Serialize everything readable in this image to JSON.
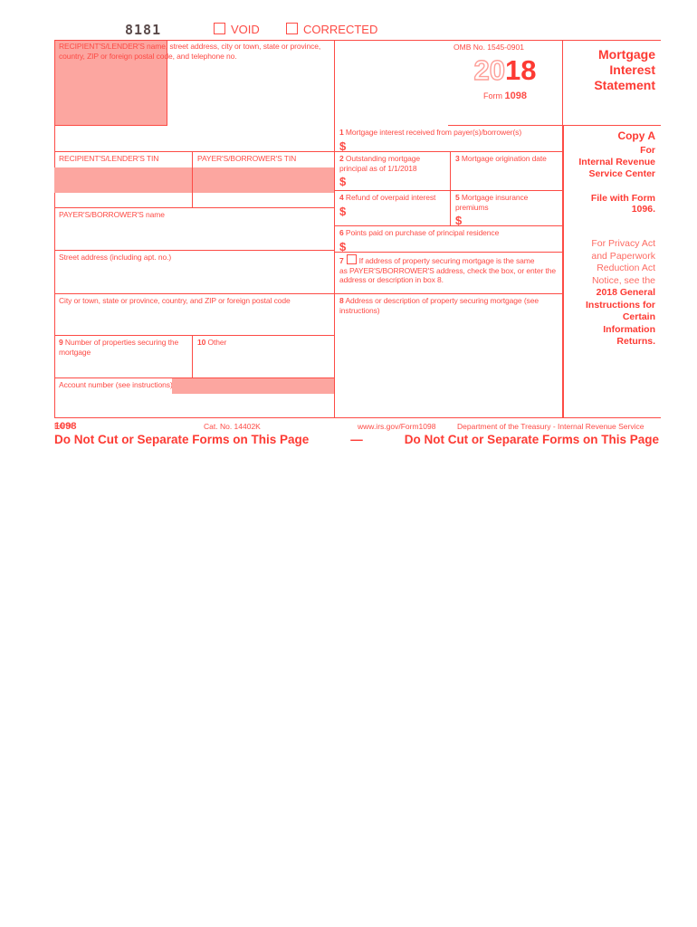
{
  "header": {
    "form_code": "8181",
    "void_label": "VOID",
    "corrected_label": "CORRECTED"
  },
  "omb": {
    "omb_number": "OMB No. 1545-0901",
    "year_prefix": "20",
    "year_suffix": "18",
    "form_word": "Form",
    "form_number": "1098"
  },
  "title": {
    "line1": "Mortgage",
    "line2": "Interest",
    "line3": "Statement"
  },
  "left_column": {
    "recipient_label": "RECIPIENT'S/LENDER'S name, street address, city or town, state or province, country, ZIP or foreign postal code, and telephone no.",
    "recipient_tin_label": "RECIPIENT'S/LENDER'S TIN",
    "payer_tin_label": "PAYER'S/BORROWER'S TIN",
    "payer_name_label": "PAYER'S/BORROWER'S name",
    "street_label": "Street address (including apt. no.)",
    "city_label": "City or town, state or province, country, and ZIP or foreign postal code",
    "box9_num": "9",
    "box9_label": "Number of properties securing the mortgage",
    "box10_num": "10",
    "box10_label": "Other",
    "account_label": "Account number (see instructions)"
  },
  "boxes": {
    "box1_num": "1",
    "box1_label": "Mortgage interest received from payer(s)/borrower(s)",
    "box1_currency": "$",
    "box2_num": "2",
    "box2_label": "Outstanding mortgage principal as of 1/1/2018",
    "box2_currency": "$",
    "box3_num": "3",
    "box3_label": "Mortgage origination date",
    "box4_num": "4",
    "box4_label": "Refund of overpaid interest",
    "box4_currency": "$",
    "box5_num": "5",
    "box5_label": "Mortgage insurance premiums",
    "box5_currency": "$",
    "box6_num": "6",
    "box6_label": "Points paid on purchase of principal residence",
    "box6_currency": "$",
    "box7_num": "7",
    "box7_text_a": "If address of property securing mortgage is the same",
    "box7_text_b": "as PAYER'S/BORROWER'S address, check the box, or enter the address or description in box 8.",
    "box8_num": "8",
    "box8_label": "Address or description of property securing mortgage (see instructions)"
  },
  "right_column": {
    "copy_a": "Copy A",
    "for": "For",
    "irs_line1": "Internal Revenue",
    "irs_line2": "Service Center",
    "file_with": "File with Form 1096.",
    "privacy": [
      "For Privacy Act",
      "and Paperwork",
      "Reduction Act",
      "Notice, see the",
      "2018 General",
      "Instructions for",
      "Certain",
      "Information",
      "Returns."
    ],
    "privacy_bold_from": 4
  },
  "footer": {
    "form_word": "Form",
    "form_number": "1098",
    "cat_no": "Cat. No. 14402K",
    "url": "www.irs.gov/Form1098",
    "department": "Department of the Treasury - Internal Revenue Service",
    "cut_line_left": "Do Not Cut or Separate Forms on This Page",
    "cut_line_dash": "—",
    "cut_line_right": "Do Not Cut or Separate Forms on This Page"
  },
  "colors": {
    "form_red": "#fd4b45",
    "bright_red": "#fd3a33",
    "pink_fill": "#fca6a0"
  }
}
